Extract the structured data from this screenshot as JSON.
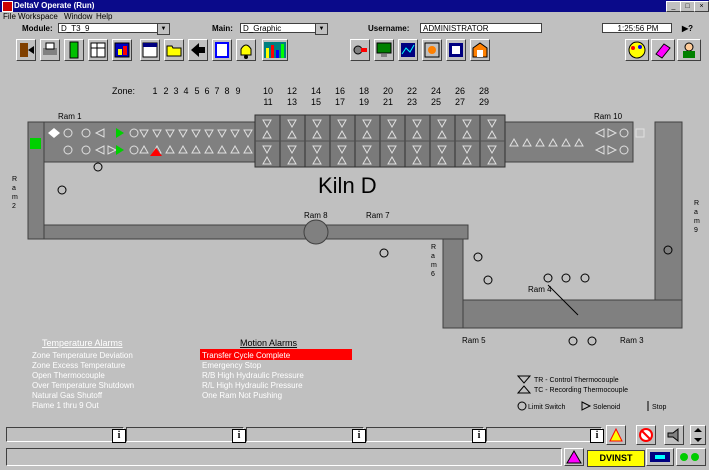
{
  "window": {
    "title": "DeltaV Operate (Run)"
  },
  "menu": {
    "items": [
      "File",
      "Workspace",
      "Window",
      "Help"
    ]
  },
  "info": {
    "module_label": "Module:",
    "module_value": "D_T3_9",
    "main_label": "Main:",
    "main_value": "D_Graphic",
    "user_label": "Username:",
    "user_value": "ADMINISTRATOR",
    "time": "1:25:56 PM"
  },
  "kiln": {
    "title": "Kiln D",
    "zone_label": "Zone:",
    "zones_top": [
      "1",
      "2",
      "3",
      "4",
      "5",
      "6",
      "7",
      "8",
      "9",
      "10",
      "12",
      "14",
      "16",
      "18",
      "20",
      "22",
      "24",
      "26",
      "28"
    ],
    "zones_bottom": [
      "11",
      "13",
      "15",
      "17",
      "19",
      "21",
      "23",
      "25",
      "27",
      "29"
    ],
    "rams": {
      "ram1": "Ram 1",
      "ram10": "Ram 10",
      "ram2": "R\na\nm\n2",
      "ram9": "R\na\nm\n9",
      "ram8": "Ram 8",
      "ram7": "Ram 7",
      "ram6": "R\na\nm\n6",
      "ram4": "Ram 4",
      "ram5": "Ram 5",
      "ram3": "Ram 3"
    }
  },
  "alarms": {
    "temperature_title": "Temperature Alarms",
    "temperature": [
      "Zone Temperature Deviation",
      "Zone Excess Temperature",
      "Open Thermocouple",
      "Over Temperature Shutdown",
      "Natural Gas Shutoff",
      "Flame 1 thru 9 Out"
    ],
    "motion_title": "Motion Alarms",
    "motion": [
      "Transfer Cycle Complete",
      "Emergency Stop",
      "R/B High Hydraulic Pressure",
      "R/L High Hydraulic Pressure",
      "One Ram Not Pushing"
    ],
    "active_color": "#ff0000"
  },
  "legend": {
    "tr": "TR - Control Thermocouple",
    "tc": "TC - Recording Thermocouple",
    "limit": "Limit Switch",
    "solenoid": "Solenoid",
    "stop": "Stop"
  },
  "status": {
    "station": "DVINST"
  },
  "colors": {
    "active_green": "#00d000",
    "alarm_red": "#ff0000",
    "conveyor": "#808080"
  }
}
